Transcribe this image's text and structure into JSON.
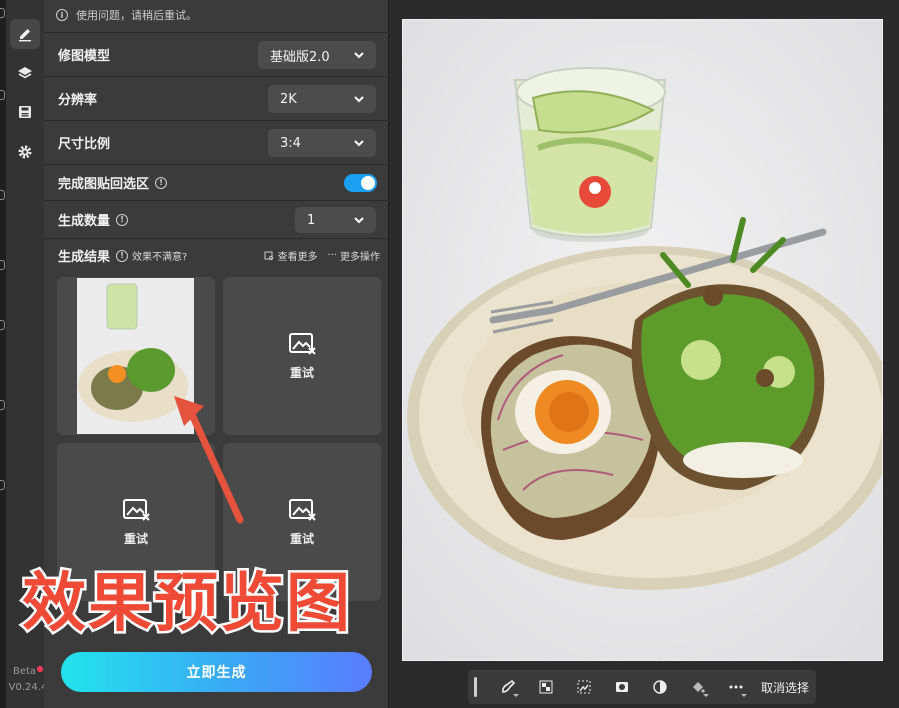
{
  "notice": {
    "text": "使用问题，请稍后重试。"
  },
  "rail": {
    "items": [
      "brush-icon",
      "layers-icon",
      "save-icon",
      "gear-icon"
    ],
    "beta_label": "Beta",
    "version": "V0.24.4"
  },
  "settings": {
    "model": {
      "label": "修图模型",
      "value": "基础版2.0"
    },
    "resolution": {
      "label": "分辨率",
      "value": "2K"
    },
    "aspect": {
      "label": "尺寸比例",
      "value": "3:4"
    },
    "paste_back": {
      "label": "完成图贴回选区",
      "enabled": true
    },
    "count": {
      "label": "生成数量",
      "value": "1"
    }
  },
  "results": {
    "title": "生成结果",
    "feedback": "效果不满意?",
    "view_more": "查看更多",
    "more_actions": "更多操作",
    "cells": [
      {
        "type": "image"
      },
      {
        "type": "retry",
        "label": "重试"
      },
      {
        "type": "retry",
        "label": "重试"
      },
      {
        "type": "retry",
        "label": "重试"
      }
    ]
  },
  "overlay": {
    "text": "效果预览图"
  },
  "generate_button": {
    "label": "立即生成"
  },
  "canvas_toolbar": {
    "tools": [
      "lasso-brush-icon",
      "checker-select-icon",
      "select-subject-icon",
      "mask-icon",
      "invert-icon",
      "fill-icon",
      "more-icon"
    ],
    "deselect_label": "取消选择"
  },
  "colors": {
    "accent": "#1aa0f0",
    "annotation": "#ee4a36",
    "button_gradient": [
      "#22e3ec",
      "#5a7cff"
    ]
  }
}
